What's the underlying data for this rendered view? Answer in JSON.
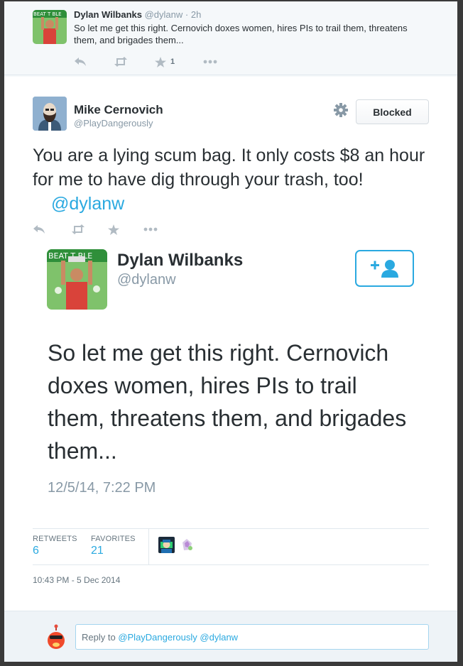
{
  "parent_tweet": {
    "name": "Dylan Wilbanks",
    "handle": "@dylanw",
    "separator": "·",
    "time": "2h",
    "text": "So let me get this right. Cernovich doxes women, hires PIs to trail them, threatens them, and brigades them...",
    "favorite_count": "1",
    "avatar_banner_text": "BEAT T  BLE"
  },
  "main_tweet": {
    "name": "Mike Cernovich",
    "handle": "@PlayDangerously",
    "blocked_label": "Blocked",
    "text": "You are a lying scum bag. It only costs $8 an hour for me to have dig through your trash, too!",
    "mention": "@dylanw"
  },
  "embedded_card": {
    "name": "Dylan Wilbanks",
    "handle": "@dylanw",
    "text": "So let me get this right. Cernovich doxes women, hires PIs to trail them, threatens them, and brigades them...",
    "date": "12/5/14, 7:22 PM",
    "avatar_banner_text": "BEAT T  BLE"
  },
  "stats": {
    "retweets_label": "RETWEETS",
    "retweets_count": "6",
    "favorites_label": "FAVORITES",
    "favorites_count": "21"
  },
  "timestamp": "10:43 PM - 5 Dec 2014",
  "reply": {
    "prefix": "Reply to ",
    "mentions": "@PlayDangerously @dylanw"
  },
  "colors": {
    "accent": "#2aa9e0",
    "muted": "#8899a6",
    "text": "#292f33"
  },
  "icons": [
    "reply-icon",
    "retweet-icon",
    "star-icon",
    "more-icon",
    "gear-icon",
    "follow-icon"
  ]
}
